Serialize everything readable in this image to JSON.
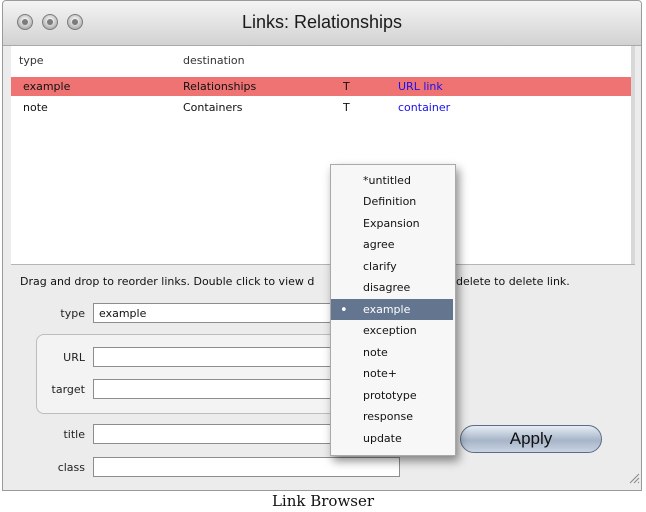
{
  "window": {
    "title": "Links: Relationships"
  },
  "table": {
    "columns": [
      "type",
      "destination"
    ],
    "rows": [
      {
        "type": "example",
        "destination": "Relationships",
        "flag": "T",
        "link": "URL link",
        "selected": true
      },
      {
        "type": "note",
        "destination": "Containers",
        "flag": "T",
        "link": "container",
        "selected": false
      }
    ]
  },
  "hint": {
    "before": "Drag and drop to reorder links. Double click to view d",
    "after": "delete to delete link."
  },
  "form": {
    "type_label": "type",
    "type_value": "example",
    "url_label": "URL",
    "url_value": "",
    "target_label": "target",
    "target_value": "",
    "title_label": "title",
    "title_value": "",
    "class_label": "class",
    "class_value": ""
  },
  "menu": {
    "items": [
      "*untitled",
      "Definition",
      "Expansion",
      "agree",
      "clarify",
      "disagree",
      "example",
      "exception",
      "note",
      "note+",
      "prototype",
      "response",
      "update"
    ],
    "selected": "example"
  },
  "apply_label": "Apply",
  "caption": "Link Browser",
  "colors": {
    "selection_row": "#f07373",
    "menu_highlight": "#64758f",
    "link_text": "#1a10f0"
  }
}
